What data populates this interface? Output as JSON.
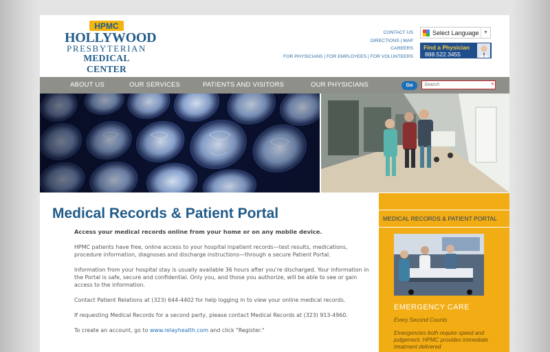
{
  "header": {
    "logo": {
      "mark_text": "HPMC",
      "line1": "HOLLYWOOD",
      "line2": "PRESBYTERIAN",
      "line3": "MEDICAL CENTER"
    },
    "top_links": {
      "contact": "CONTACT US",
      "directions": "DIRECTIONS | MAP",
      "careers": "CAREERS",
      "audiences": "FOR PHYSICIANS | FOR EMPLOYEES | FOR VOLUNTEERS"
    },
    "language_select": {
      "label": "Select Language"
    },
    "find_physician": {
      "title": "Find a Physician",
      "phone": "888.522.3455"
    }
  },
  "nav": {
    "items": [
      {
        "label": "ABOUT US"
      },
      {
        "label": "OUR SERVICES"
      },
      {
        "label": "PATIENTS AND VISITORS"
      },
      {
        "label": "OUR PHYSICIANS"
      }
    ],
    "go_label": "Go",
    "search_placeholder": "Search"
  },
  "main": {
    "title": "Medical Records & Patient Portal",
    "lead": "Access your medical records online from your home or on any mobile device.",
    "p1": "HPMC patients have free, online access to your hospital inpatient records—test results, medications, procedure information, diagnoses and discharge instructions—through a secure Patient Portal.",
    "p2": "Information from your hospital stay is usually available 36 hours after you're discharged. Your information in the Portal is safe, secure and confidential. Only you, and those you authorize, will be able to see or gain access to the information.",
    "p3": "Contact Patient Relations at (323) 644-4402 for help logging in to view your online medical records.",
    "p4": "If requesting Medical Records for a second party, please contact Medical Records at (323) 913-4960.",
    "p5_before": "To create an account, go to ",
    "p5_link": "www.relayhealth.com",
    "p5_after": " and click \"Register.\""
  },
  "sidebar": {
    "heading": "MEDICAL RECORDS & PATIENT PORTAL",
    "feature_title": "EMERGENCY CARE",
    "feature_subtitle": "Every Second Counts",
    "feature_text": "Emergencies both require speed and judgement. HPMC provides immediate treatment delivered"
  },
  "colors": {
    "brand_blue": "#1f5a88",
    "nav_gray": "#8f8f8a",
    "sidebar_gold": "#f2ad14",
    "link_blue": "#1f6fb8"
  },
  "icons": {
    "language": "google-translate-icon",
    "dropdown": "dropdown-arrow-icon",
    "search_clear": "close-icon"
  }
}
